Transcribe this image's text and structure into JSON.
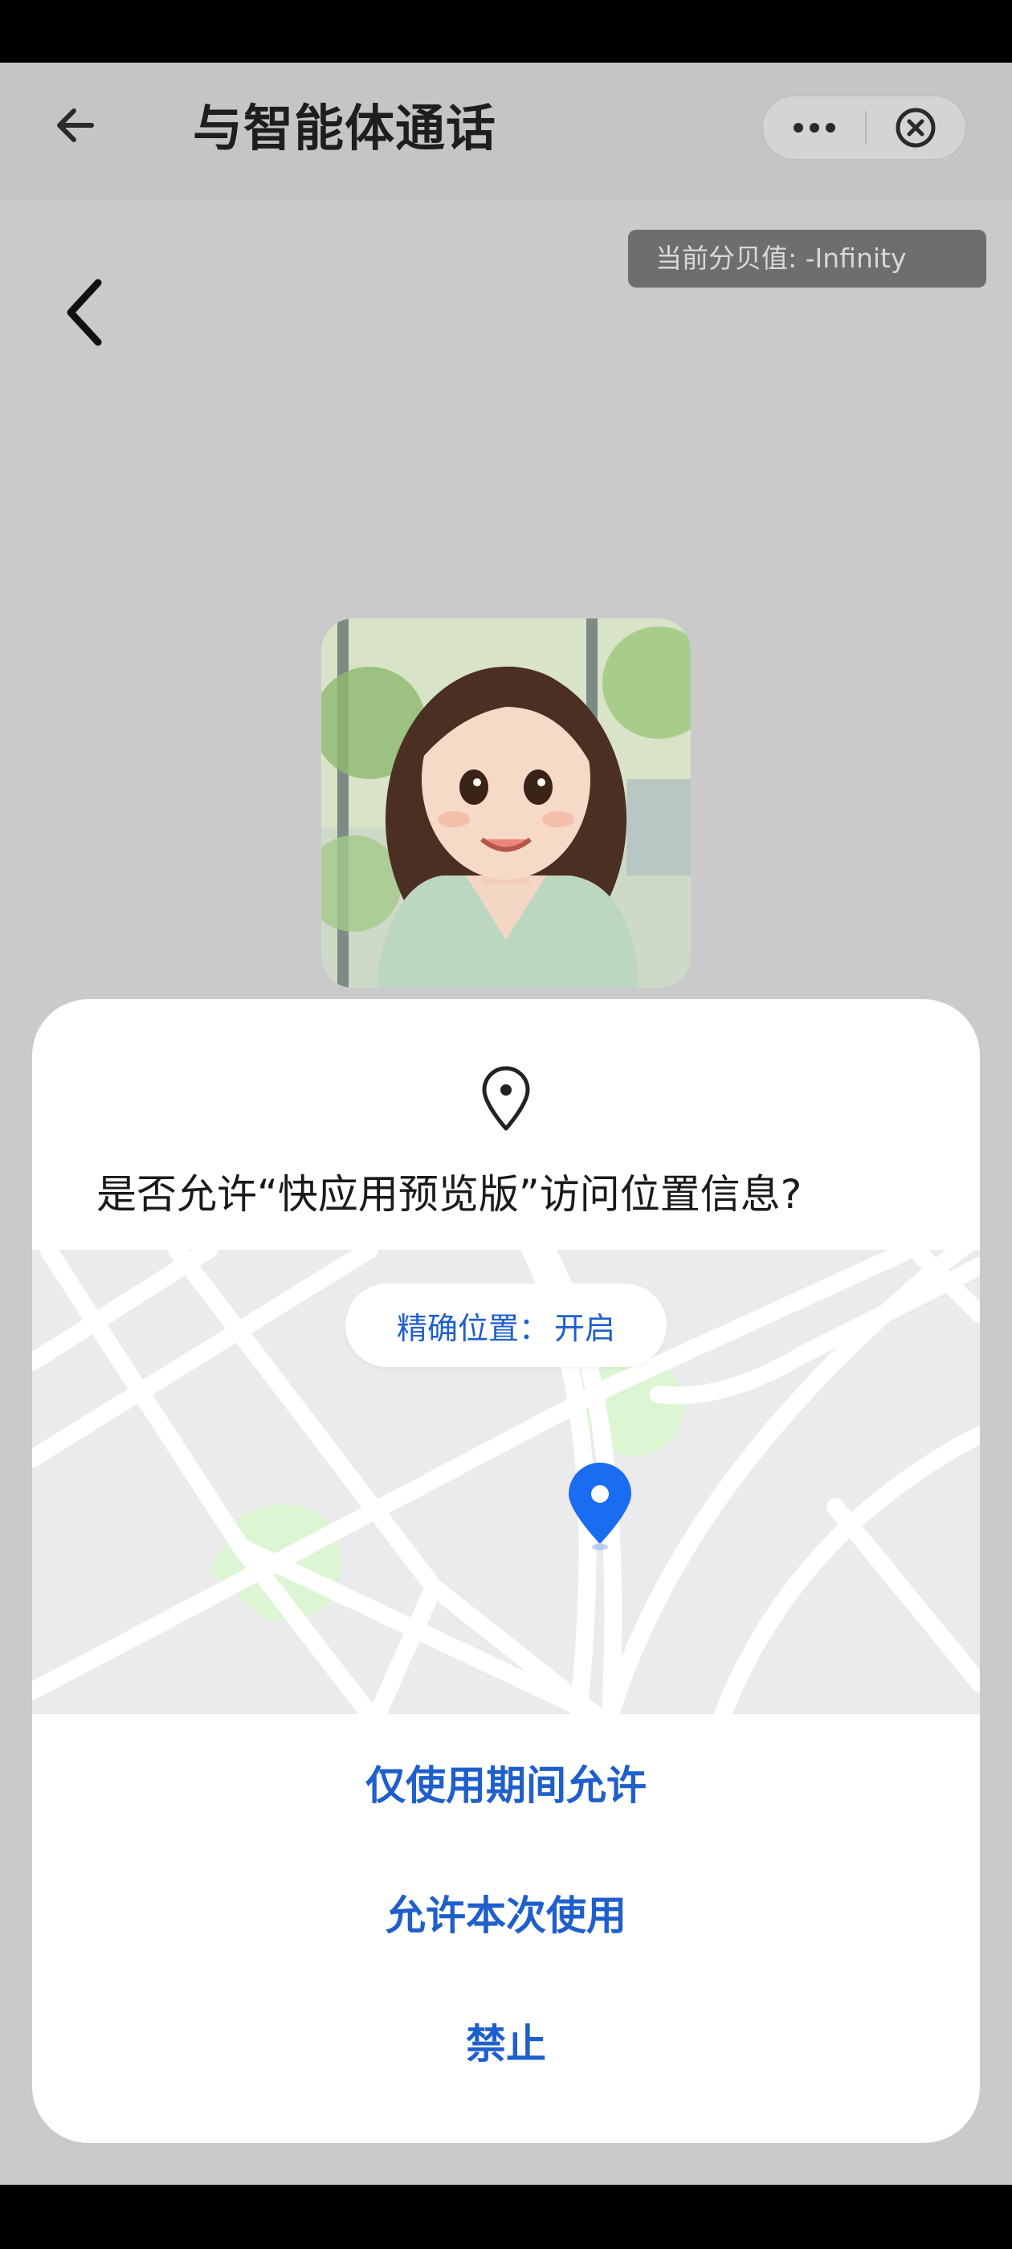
{
  "navbar": {
    "title": "与智能体通话",
    "back_icon": "arrow-left-icon",
    "more_icon": "more-dots-icon",
    "close_icon": "close-circle-icon"
  },
  "decibel_badge": {
    "text": "当前分贝值: -Infinity"
  },
  "page": {
    "back_icon": "chevron-left-icon",
    "avatar": "cartoon-girl-avatar"
  },
  "permission_dialog": {
    "icon": "location-pin-icon",
    "title": "是否允许“快应用预览版”访问位置信息?",
    "precise_location_label": "精确位置：",
    "precise_location_value": "开启",
    "buttons": {
      "allow_while_using": "仅使用期间允许",
      "allow_once": "允许本次使用",
      "deny": "禁止"
    }
  },
  "colors": {
    "accent": "#1f5fcc",
    "map_pin": "#1a6cf0",
    "overlay_bg": "#cacaca",
    "map_bg": "#ebebed",
    "park_green": "#dcf5d2"
  }
}
